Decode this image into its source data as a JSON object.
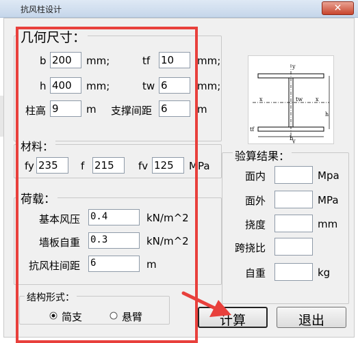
{
  "window": {
    "title": "抗风柱设计",
    "close_glyph": "✕"
  },
  "dimensions": {
    "title": "几何尺寸：",
    "b_label": "b",
    "b_value": "200",
    "b_unit": "mm;",
    "tf_label": "tf",
    "tf_value": "10",
    "tf_unit": "mm;",
    "h_label": "h",
    "h_value": "400",
    "h_unit": "mm;",
    "tw_label": "tw",
    "tw_value": "6",
    "tw_unit": "mm;",
    "height_label": "柱高",
    "height_value": "9",
    "height_unit": "m",
    "support_label": "支撑间距",
    "support_value": "6",
    "support_unit": "m"
  },
  "material": {
    "title": "材料：",
    "fy_label": "fy",
    "fy_value": "235",
    "f_label": "f",
    "f_value": "215",
    "fv_label": "fv",
    "fv_value": "125",
    "unit": "MPa"
  },
  "load": {
    "title": "荷载：",
    "wind_label": "基本风压",
    "wind_value": "0.4",
    "wind_unit": "kN/m^2",
    "wall_label": "墙板自重",
    "wall_value": "0.3",
    "wall_unit": "kN/m^2",
    "spacing_label": "抗风柱间距",
    "spacing_value": "6",
    "spacing_unit": "m"
  },
  "structure": {
    "title": "结构形式：",
    "options": [
      "简支",
      "悬臂"
    ],
    "selected": "简支"
  },
  "results": {
    "title": "验算结果：",
    "rows": [
      {
        "label": "面内",
        "value": "",
        "unit": "Mpa"
      },
      {
        "label": "面外",
        "value": "",
        "unit": "MPa"
      },
      {
        "label": "挠度",
        "value": "",
        "unit": "mm"
      },
      {
        "label": "跨挠比",
        "value": "",
        "unit": ""
      },
      {
        "label": "自重",
        "value": "",
        "unit": "kg"
      }
    ]
  },
  "diagram": {
    "y_top": "y",
    "y_bottom": "y",
    "x_left": "x",
    "x_right": "x",
    "tw": "tw",
    "tf": "tf",
    "b": "b",
    "h": "h"
  },
  "buttons": {
    "calculate": "计算",
    "exit": "退出"
  },
  "annotation_color": "#e8403c"
}
